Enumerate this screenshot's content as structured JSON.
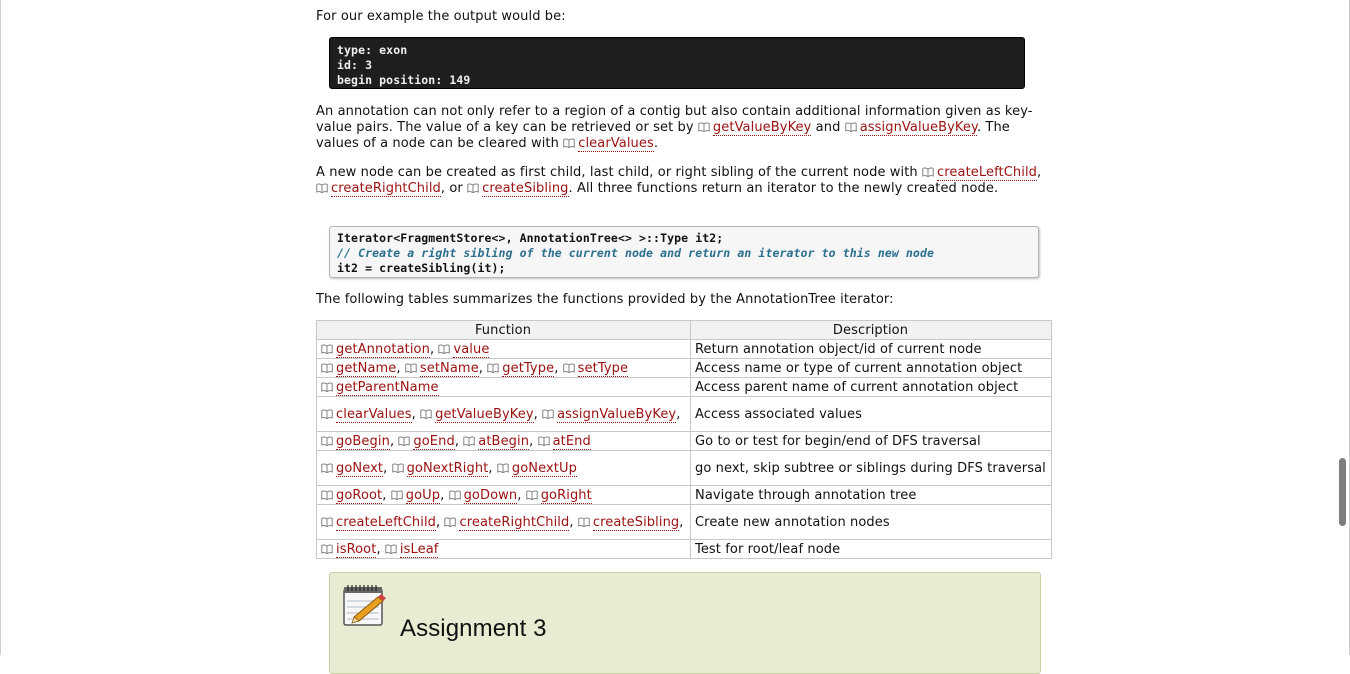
{
  "intro_text": "For our example the output would be:",
  "output_code": "type: exon\nid: 3\nbegin position: 149",
  "annot_para": {
    "t1": "An annotation can not only refer to a region of a contig but also contain additional information given as key-value pairs. The value of a key can be retrieved or set by ",
    "link1": "getValueByKey",
    "t2": " and ",
    "link2": "assignValueByKey",
    "t3": ". The values of a node can be cleared with ",
    "link3": "clearValues",
    "t4": "."
  },
  "node_para": {
    "t1": "A new node can be created as first child, last child, or right sibling of the current node with ",
    "link1": "createLeftChild",
    "t2": ", ",
    "link2": "createRightChild",
    "t3": ", or ",
    "link3": "createSibling",
    "t4": ". All three functions return an iterator to the newly created node."
  },
  "code2": {
    "line1": "Iterator<FragmentStore<>, AnnotationTree<> >::Type it2;",
    "line2": "// Create a right sibling of the current node and return an iterator to this new node",
    "line3": "it2 = createSibling(it);"
  },
  "tables_intro": "The following tables summarizes the functions provided by the AnnotationTree iterator:",
  "table": {
    "header_function": "Function",
    "header_description": "Description",
    "rows": [
      {
        "fns": [
          "getAnnotation",
          "value"
        ],
        "desc": "Return annotation object/id of current node"
      },
      {
        "fns": [
          "getName",
          "setName",
          "getType",
          "setType"
        ],
        "desc": "Access name or type of current annotation object"
      },
      {
        "fns": [
          "getParentName"
        ],
        "desc": "Access parent name of current annotation object"
      },
      {
        "fns": [
          "clearValues",
          "getValueByKey",
          "assignValueByKey"
        ],
        "desc": "Access associated values"
      },
      {
        "fns": [
          "goBegin",
          "goEnd",
          "atBegin",
          "atEnd"
        ],
        "desc": "Go to or test for begin/end of DFS traversal"
      },
      {
        "fns": [
          "goNext",
          "goNextRight",
          "goNextUp"
        ],
        "desc": "go next, skip subtree or siblings during DFS traversal"
      },
      {
        "fns": [
          "goRoot",
          "goUp",
          "goDown",
          "goRight"
        ],
        "desc": "Navigate through annotation tree"
      },
      {
        "fns": [
          "createLeftChild",
          "createRightChild",
          "createSibling"
        ],
        "desc": "Create new annotation nodes"
      },
      {
        "fns": [
          "isRoot",
          "isLeaf"
        ],
        "desc": "Test for root/leaf node"
      }
    ]
  },
  "assignment_title": "Assignment 3",
  "colors": {
    "link": "#9b1010",
    "code_bg": "#1e1e1e",
    "assignment_bg": "#e9ecd3"
  },
  "icons": [
    "book-icon",
    "notepad-pencil-icon"
  ]
}
